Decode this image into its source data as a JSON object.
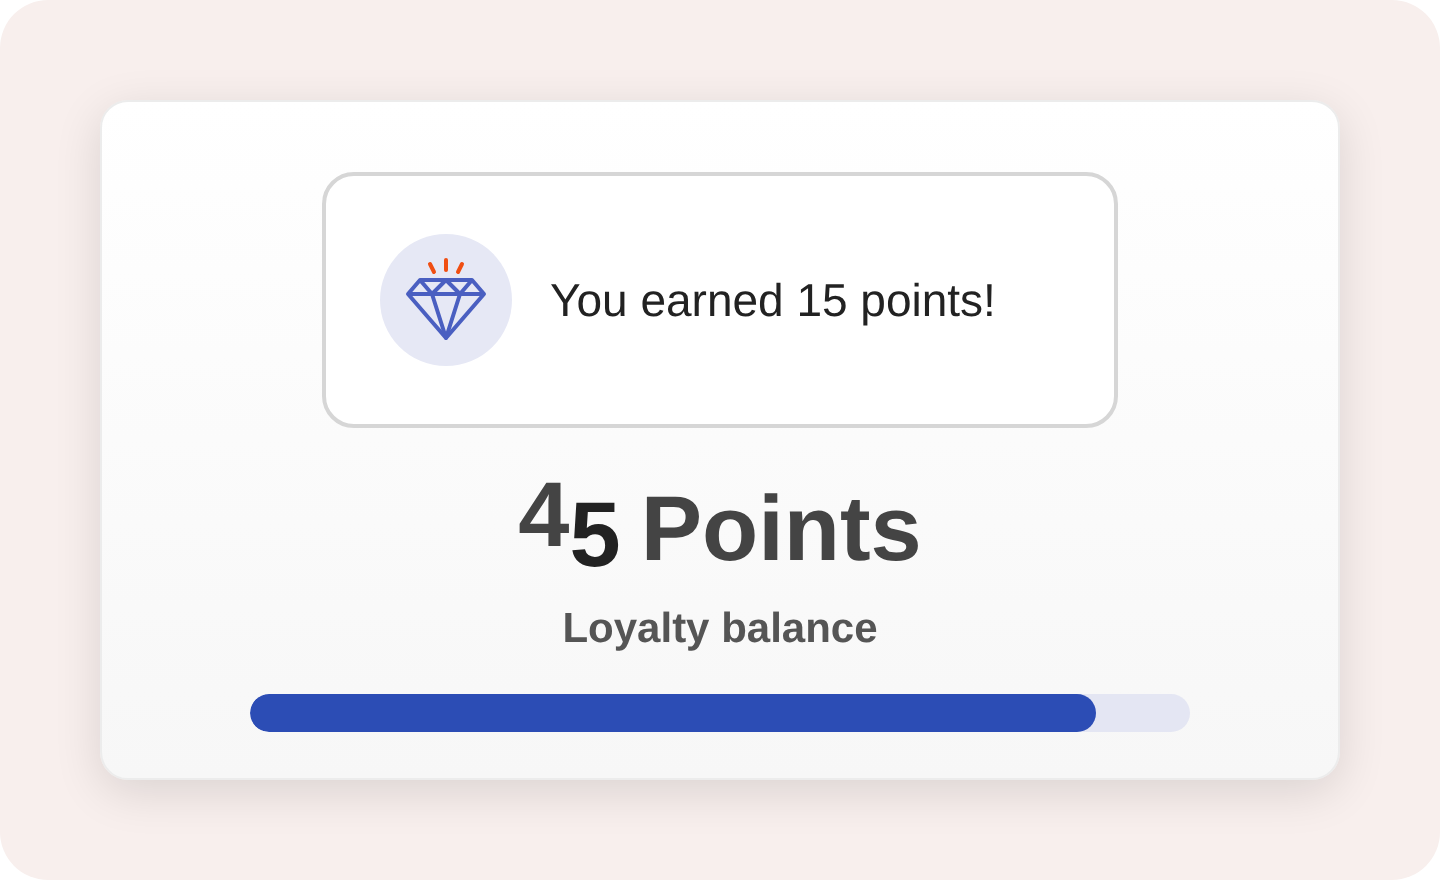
{
  "toast": {
    "message": "You earned 15 points!"
  },
  "balance": {
    "digits": [
      "4",
      "5"
    ],
    "rolling": true,
    "unit": "Points",
    "label": "Loyalty balance"
  },
  "progress": {
    "level": 0.9
  }
}
